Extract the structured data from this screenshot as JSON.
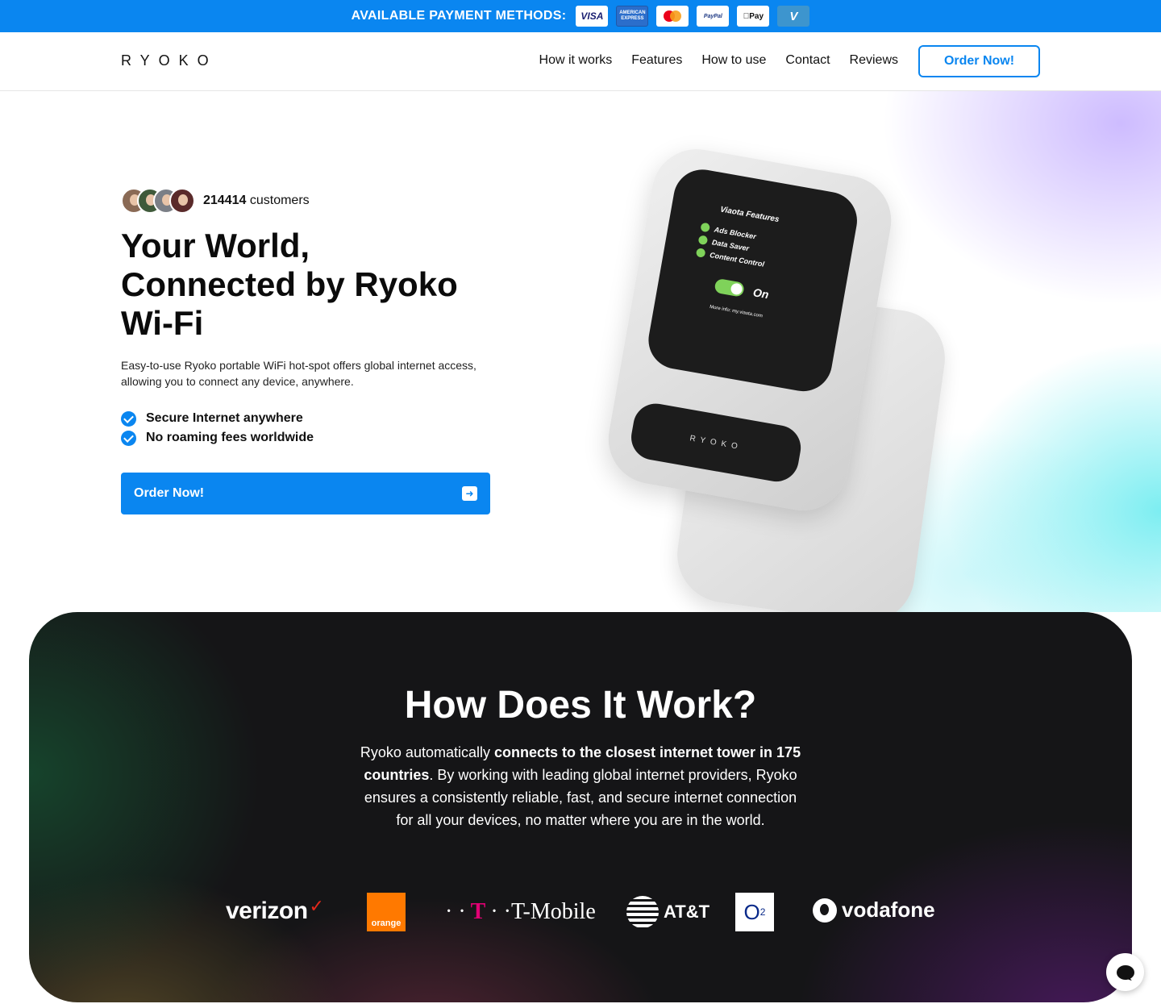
{
  "payment_bar": {
    "label": "AVAILABLE PAYMENT METHODS:",
    "methods": [
      {
        "name": "visa-icon",
        "text": "VISA"
      },
      {
        "name": "amex-icon",
        "text": "AMERICAN EXPRESS"
      },
      {
        "name": "mastercard-icon",
        "text": ""
      },
      {
        "name": "paypal-icon",
        "text": "PayPal"
      },
      {
        "name": "apple-pay-icon",
        "text": "Pay"
      },
      {
        "name": "venmo-icon",
        "text": "V"
      }
    ],
    "color": "#0a86f0"
  },
  "header": {
    "logo": "RYOKO",
    "nav": [
      "How it works",
      "Features",
      "How to use",
      "Contact",
      "Reviews"
    ],
    "cta": "Order Now!"
  },
  "hero": {
    "customers_count": "214414",
    "customers_label": "customers",
    "title": "Your World, Connected by Ryoko Wi-Fi",
    "subtitle": "Easy-to-use Ryoko portable WiFi hot-spot offers global internet access, allowing you to connect any device, anywhere.",
    "features": [
      "Secure Internet anywhere",
      "No roaming fees worldwide"
    ],
    "cta": "Order Now!",
    "device": {
      "screen_title": "Viaota Features",
      "screen_items": [
        "Ads Blocker",
        "Data Saver",
        "Content Control"
      ],
      "toggle_label": "On",
      "more_info": "More info: my.viaota.com",
      "brand": "RYOKO"
    }
  },
  "how": {
    "title": "How Does It Work?",
    "text_before": "Ryoko automatically ",
    "text_bold": "connects to the closest internet tower in 175 countries",
    "text_after": ". By working with leading global internet providers, Ryoko ensures a consistently reliable, fast, and secure internet connection for all your devices, no matter where you are in the world.",
    "carriers": [
      "verizon",
      "orange",
      "T-Mobile",
      "AT&T",
      "O2",
      "vodafone"
    ]
  },
  "colors": {
    "accent": "#0a86f0",
    "dark": "#151517"
  }
}
